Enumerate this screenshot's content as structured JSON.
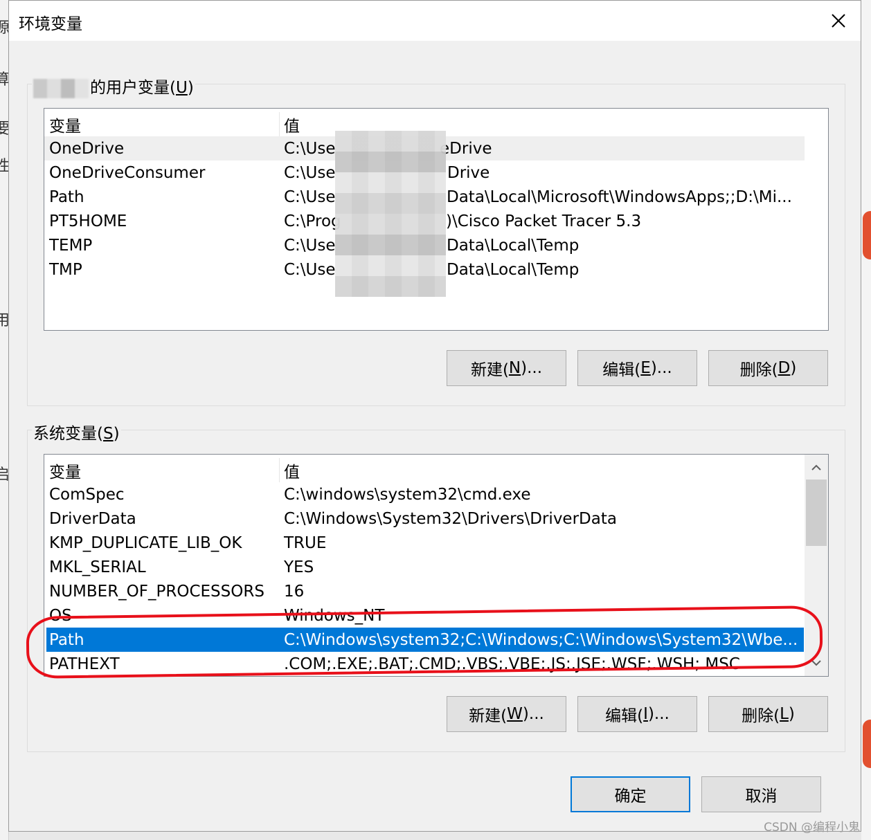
{
  "dialog": {
    "title": "环境变量",
    "close_glyph": "✕"
  },
  "user_vars": {
    "label_prefix": "",
    "label": "的用户变量(",
    "hotkey": "U",
    "label_suffix": ")",
    "columns": [
      "变量",
      "值"
    ],
    "rows": [
      {
        "name": "OneDrive",
        "value_a": "C:\\Use",
        "value_b": "eDrive"
      },
      {
        "name": "OneDriveConsumer",
        "value_a": "C:\\Use",
        "value_b": "Drive"
      },
      {
        "name": "Path",
        "value_a": "C:\\Use",
        "value_b": "Data\\Local\\Microsoft\\WindowsApps;;D:\\Mi..."
      },
      {
        "name": "PT5HOME",
        "value_a": "C:\\Prog",
        "value_b": ")\\Cisco Packet Tracer 5.3"
      },
      {
        "name": "TEMP",
        "value_a": "C:\\Use",
        "value_b": "Data\\Local\\Temp"
      },
      {
        "name": "TMP",
        "value_a": "C:\\Use",
        "value_b": "Data\\Local\\Temp"
      }
    ],
    "buttons": {
      "new": {
        "pre": "新建(",
        "key": "N",
        "post": ")..."
      },
      "edit": {
        "pre": "编辑(",
        "key": "E",
        "post": ")..."
      },
      "delete": {
        "pre": "删除(",
        "key": "D",
        "post": ")"
      }
    }
  },
  "system_vars": {
    "label": "系统变量(",
    "hotkey": "S",
    "label_suffix": ")",
    "columns": [
      "变量",
      "值"
    ],
    "rows": [
      {
        "name": "ComSpec",
        "value": "C:\\windows\\system32\\cmd.exe"
      },
      {
        "name": "DriverData",
        "value": "C:\\Windows\\System32\\Drivers\\DriverData"
      },
      {
        "name": "KMP_DUPLICATE_LIB_OK",
        "value": "TRUE"
      },
      {
        "name": "MKL_SERIAL",
        "value": "YES"
      },
      {
        "name": "NUMBER_OF_PROCESSORS",
        "value": "16"
      },
      {
        "name": "OS",
        "value": "Windows_NT"
      },
      {
        "name": "Path",
        "value": "C:\\Windows\\system32;C:\\Windows;C:\\Windows\\System32\\Wbe..."
      },
      {
        "name": "PATHEXT",
        "value": ".COM;.EXE;.BAT;.CMD;.VBS;.VBE;.JS;.JSE;.WSF;.WSH;.MSC"
      }
    ],
    "selected_index": 6,
    "buttons": {
      "new": {
        "pre": "新建(",
        "key": "W",
        "post": ")..."
      },
      "edit": {
        "pre": "编辑(",
        "key": "I",
        "post": ")..."
      },
      "delete": {
        "pre": "删除(",
        "key": "L",
        "post": ")"
      }
    }
  },
  "footer": {
    "ok": "确定",
    "cancel": "取消"
  },
  "watermark": "CSDN @编程小鬼",
  "colors": {
    "selection": "#0078d7",
    "annotation": "#e8101a"
  }
}
